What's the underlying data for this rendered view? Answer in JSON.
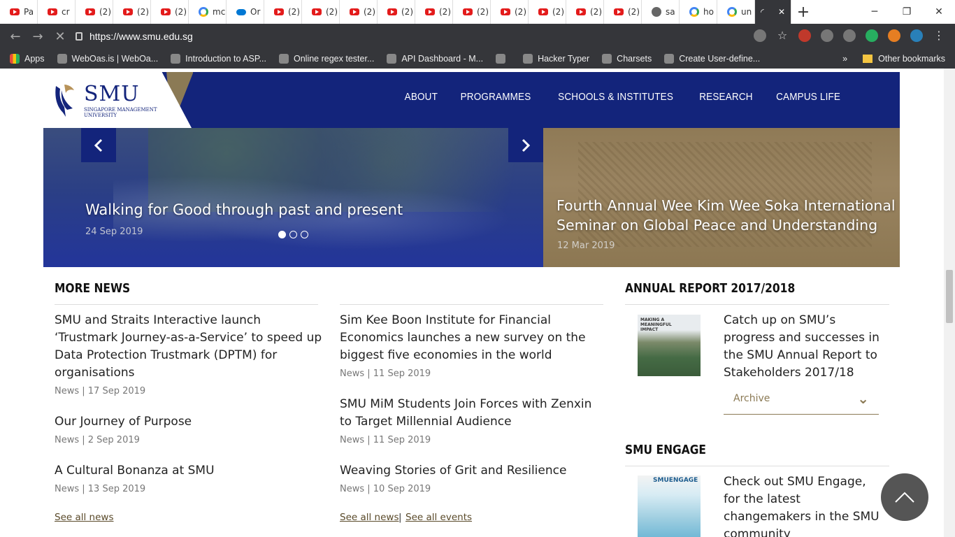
{
  "browser": {
    "tabs": [
      {
        "icon": "youtube",
        "label": "Pa"
      },
      {
        "icon": "youtube",
        "label": "cr"
      },
      {
        "icon": "youtube",
        "label": "(2)"
      },
      {
        "icon": "youtube",
        "label": "(2)"
      },
      {
        "icon": "youtube",
        "label": "(2)"
      },
      {
        "icon": "google",
        "label": "mc"
      },
      {
        "icon": "onedrive",
        "label": "Or"
      },
      {
        "icon": "youtube",
        "label": "(2)"
      },
      {
        "icon": "youtube",
        "label": "(2)"
      },
      {
        "icon": "youtube",
        "label": "(2)"
      },
      {
        "icon": "youtube",
        "label": "(2)"
      },
      {
        "icon": "youtube",
        "label": "(2)"
      },
      {
        "icon": "youtube",
        "label": "(2)"
      },
      {
        "icon": "youtube",
        "label": "(2)"
      },
      {
        "icon": "youtube",
        "label": "(2)"
      },
      {
        "icon": "youtube",
        "label": "(2)"
      },
      {
        "icon": "youtube",
        "label": "(2)"
      },
      {
        "icon": "globe",
        "label": "sa"
      },
      {
        "icon": "google",
        "label": "ho"
      },
      {
        "icon": "google",
        "label": "un"
      }
    ],
    "active_tab_close": "✕",
    "new_tab": "+",
    "url": "https://www.smu.edu.sg",
    "bookmarks": [
      "Apps",
      "WebOas.is | WebOa...",
      "Introduction to ASP...",
      "Online regex tester...",
      "API Dashboard - M...",
      "",
      "Hacker Typer",
      "Charsets",
      "Create User-define..."
    ],
    "bookmarks_more": "»",
    "other_bookmarks": "Other bookmarks"
  },
  "site": {
    "logo_text": "SMU",
    "logo_sub": "SINGAPORE MANAGEMENT UNIVERSITY",
    "nav": [
      "ABOUT",
      "PROGRAMMES",
      "SCHOOLS & INSTITUTES",
      "RESEARCH",
      "CAMPUS LIFE"
    ],
    "colors": {
      "navy": "#13247b",
      "gold": "#8b7a55"
    }
  },
  "carousel": {
    "slide1": {
      "title": "Walking for Good through past and present",
      "date": "24 Sep 2019"
    },
    "slide2": {
      "title_line1": "Fourth Annual Wee Kim Wee Soka International",
      "title_line2": "Seminar on Global Peace and Understanding",
      "date": "12 Mar 2019"
    },
    "prev": "‹",
    "next": "›",
    "active_index": 0
  },
  "more_news": {
    "title": "MORE NEWS",
    "col1": [
      {
        "lines": [
          "SMU and Straits Interactive launch",
          "‘Trustmark Journey-as-a-Service’ to speed up",
          "Data Protection Trustmark (DPTM) for",
          "organisations"
        ],
        "meta": "News | 17 Sep 2019"
      },
      {
        "lines": [
          "Our Journey of Purpose"
        ],
        "meta": "News | 2 Sep 2019"
      },
      {
        "lines": [
          "A Cultural Bonanza at SMU"
        ],
        "meta": "News | 13 Sep 2019"
      }
    ],
    "col2": [
      {
        "lines": [
          "Sim Kee Boon Institute for Financial",
          "Economics launches a new survey on the",
          "biggest five economies in the world"
        ],
        "meta": "News | 11 Sep 2019"
      },
      {
        "lines": [
          "SMU MiM Students Join Forces with Zenxin",
          "to Target Millennial Audience"
        ],
        "meta": "News | 11 Sep 2019"
      },
      {
        "lines": [
          "Weaving Stories of Grit and Resilience"
        ],
        "meta": "News | 10 Sep 2019"
      }
    ],
    "see_all_news": "See all news",
    "see_all_news_2": "See all news",
    "separator": "|",
    "see_all_events": "See all events"
  },
  "annual_report": {
    "title": "ANNUAL REPORT 2017/2018",
    "cover_text": "MAKING A MEANINGFUL IMPACT",
    "lines": [
      "Catch up on SMU’s",
      "progress and successes in",
      "the SMU Annual Report to",
      "Stakeholders 2017/18"
    ],
    "archive": "Archive"
  },
  "engage": {
    "title": "SMU ENGAGE",
    "cover_text": "SMUENGAGE",
    "lines": [
      "Check out SMU Engage,",
      "for the latest",
      "changemakers in the SMU",
      "community"
    ]
  }
}
